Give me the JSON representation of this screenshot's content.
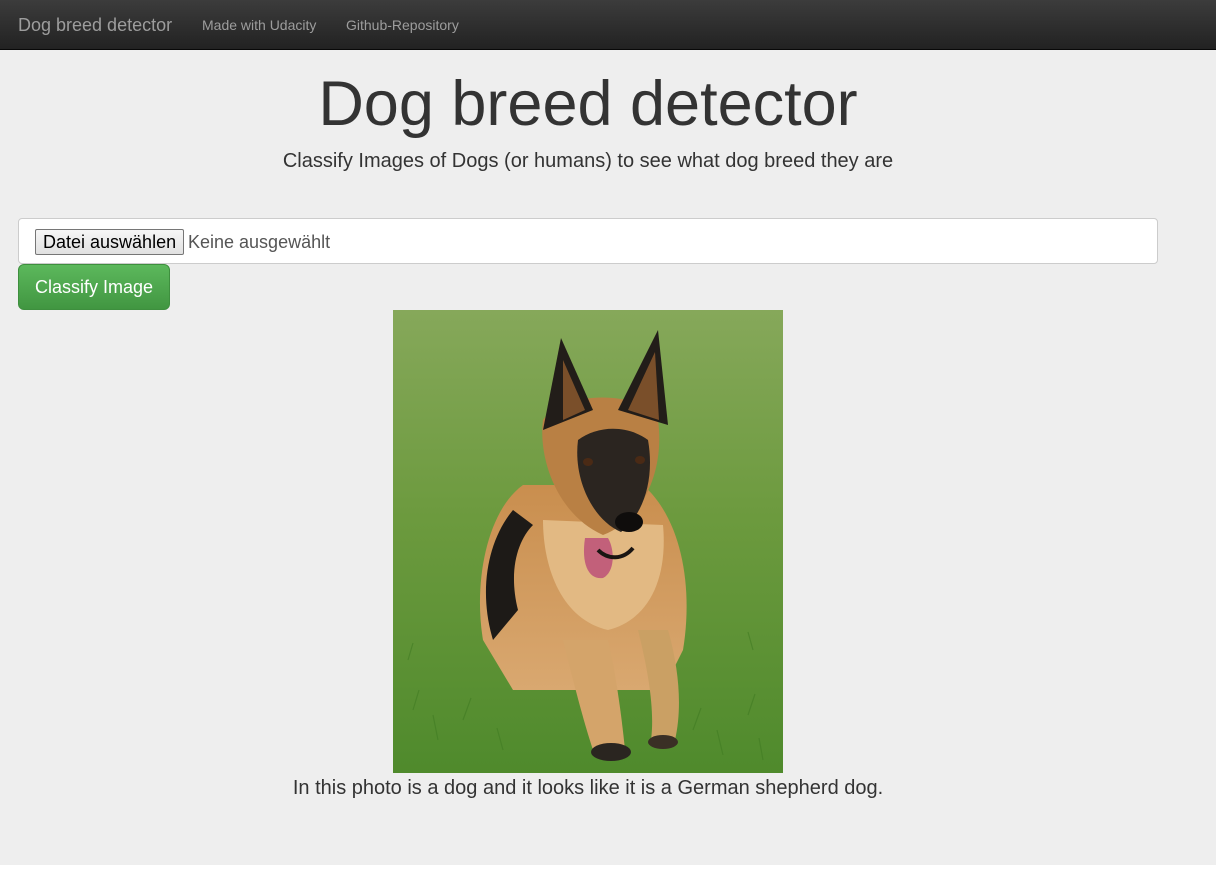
{
  "navbar": {
    "brand": "Dog breed detector",
    "links": [
      "Made with Udacity",
      "Github-Repository"
    ]
  },
  "main": {
    "title": "Dog breed detector",
    "subtitle": "Classify Images of Dogs (or humans) to see what dog breed they are",
    "file_input": {
      "button_label": "Datei auswählen",
      "status": "Keine ausgewählt"
    },
    "classify_button": "Classify Image",
    "result": "In this photo is a dog and it looks like it is a German shepherd dog."
  },
  "colors": {
    "navbar": "#222222",
    "navbar_text": "#9d9d9d",
    "jumbotron": "#eeeeee",
    "button_green": "#5cb85c"
  },
  "image": {
    "subject": "german-shepherd-dog-photo"
  }
}
